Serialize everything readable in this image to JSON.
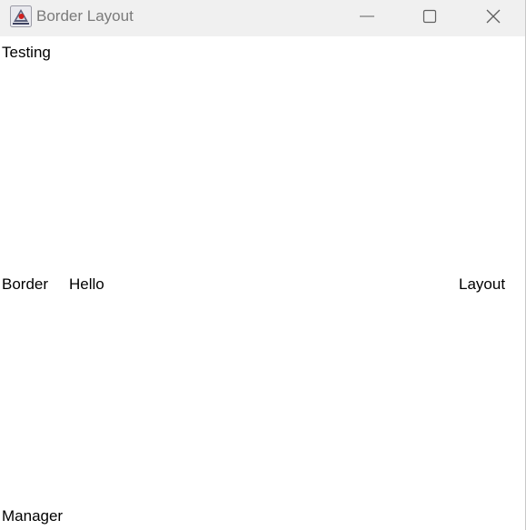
{
  "window": {
    "title": "Border Layout",
    "icon": "java-icon"
  },
  "controls": {
    "minimize_icon": "minimize-icon",
    "maximize_icon": "maximize-icon",
    "close_icon": "close-icon"
  },
  "layout": {
    "north": "Testing",
    "west": "Border",
    "center": "Hello",
    "east": "Layout",
    "south": "Manager"
  }
}
